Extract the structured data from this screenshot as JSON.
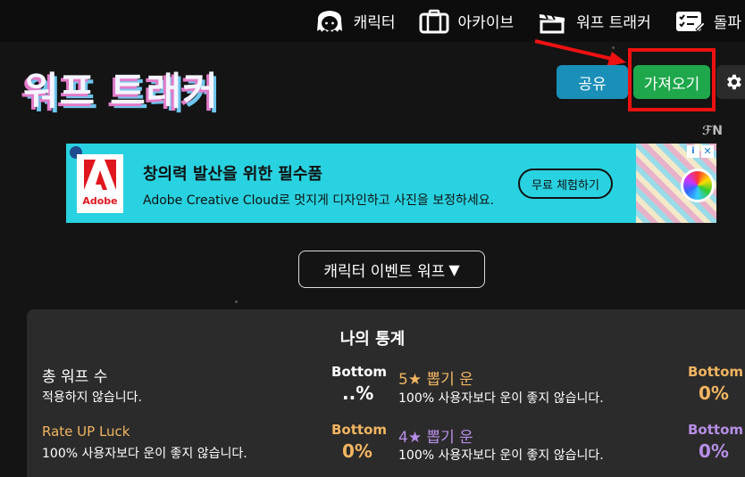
{
  "nav": {
    "items": [
      {
        "label": "캐릭터",
        "icon": "character-icon"
      },
      {
        "label": "아카이브",
        "icon": "archive-icon"
      },
      {
        "label": "워프 트래커",
        "icon": "warp-tracker-icon"
      },
      {
        "label": "돌파",
        "icon": "checklist-icon"
      }
    ]
  },
  "header": {
    "title": "워프 트래커",
    "share_label": "공유",
    "import_label": "가져오기"
  },
  "ad": {
    "label": "AdChoices",
    "brand": "Adobe",
    "headline": "창의력 발산을 위한 필수품",
    "subtext": "Adobe Creative Cloud로 멋지게 디자인하고 사진을 보정하세요.",
    "cta": "무료 체험하기",
    "corner_mark": "ℱN"
  },
  "banner": {
    "dropdown_value": "캐릭터 이벤트 워프"
  },
  "stats": {
    "title": "나의 통계",
    "total": {
      "label": "총 워프 수",
      "desc": "적용하지 않습니다.",
      "rank": "Bottom",
      "value": "..%"
    },
    "five_star": {
      "label": "5★ 뽑기 운",
      "desc": "100% 사용자보다 운이 좋지 않습니다.",
      "rank": "Bottom",
      "value": "0%"
    },
    "rate_up": {
      "label": "Rate UP Luck",
      "desc": "100% 사용자보다 운이 좋지 않습니다.",
      "rank": "Bottom",
      "value": "0%"
    },
    "four_star": {
      "label": "4★ 뽑기 운",
      "desc": "100% 사용자보다 운이 좋지 않습니다.",
      "rank": "Bottom",
      "value": "0%"
    }
  },
  "colors": {
    "gold": "#f2b560",
    "purple": "#b68ee6",
    "share": "#1a8fb8",
    "import": "#1fa84b",
    "highlight": "#ee1111"
  }
}
